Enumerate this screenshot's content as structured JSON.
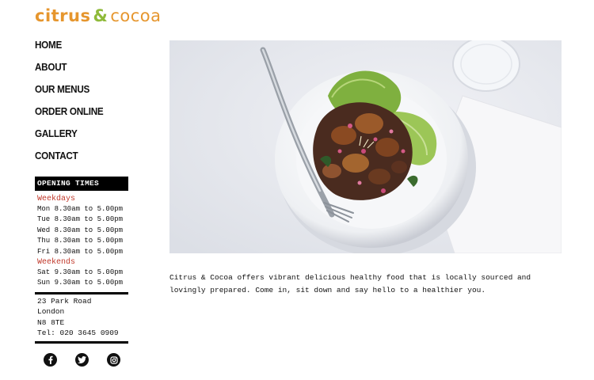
{
  "brand": {
    "name_part1": "citrus",
    "name_amp": "&",
    "name_part2": "cocoa",
    "colors": {
      "orange": "#e6962e",
      "green": "#8fba3a"
    }
  },
  "nav": {
    "items": [
      {
        "label": "HOME"
      },
      {
        "label": "ABOUT"
      },
      {
        "label": "OUR MENUS"
      },
      {
        "label": "ORDER ONLINE"
      },
      {
        "label": "GALLERY"
      },
      {
        "label": "CONTACT"
      }
    ]
  },
  "opening_times": {
    "title": "OPENING TIMES",
    "weekdays_label": "Weekdays",
    "weekdays": [
      "Mon 8.30am to 5.00pm",
      "Tue 8.30am to 5.00pm",
      "Wed 8.30am to 5.00pm",
      "Thu 8.30am to 5.00pm",
      "Fri 8.30am to 5.00pm"
    ],
    "weekends_label": "Weekends",
    "weekends": [
      "Sat 9.30am to 5.00pm",
      "Sun 9.30am to 5.00pm"
    ],
    "accent_color": "#c0392b"
  },
  "address": {
    "lines": [
      "23 Park Road",
      "London",
      "N8 8TE",
      "Tel: 020 3645 0909"
    ]
  },
  "social": {
    "icons": [
      "facebook-icon",
      "twitter-icon",
      "instagram-icon"
    ]
  },
  "intro": {
    "text": "Citrus & Cocoa offers vibrant delicious healthy food that is locally sourced and lovingly prepared. Come in, sit down and say hello to a healthier you."
  }
}
